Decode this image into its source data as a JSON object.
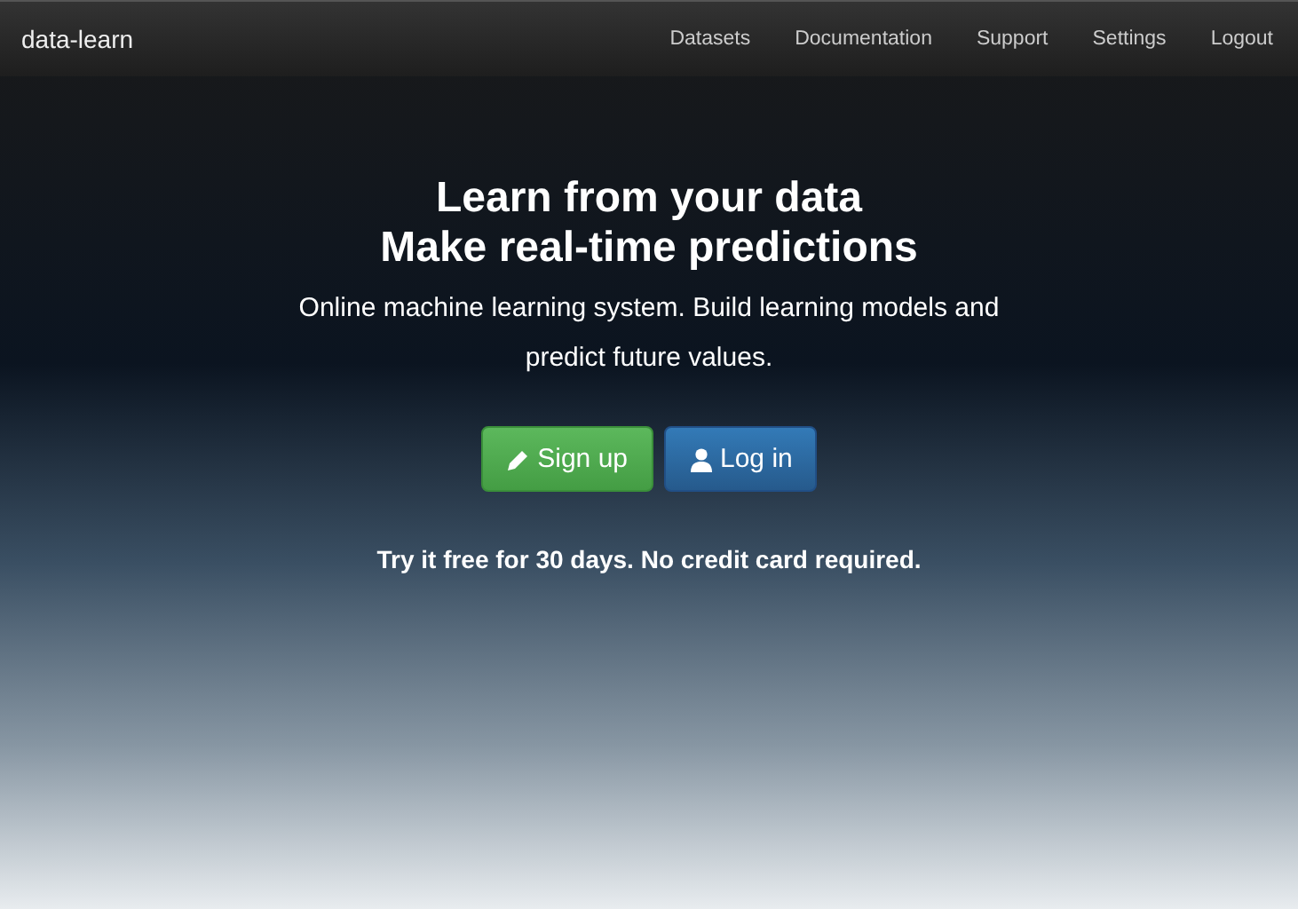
{
  "navbar": {
    "brand": "data-learn",
    "links": [
      "Datasets",
      "Documentation",
      "Support",
      "Settings",
      "Logout"
    ]
  },
  "hero": {
    "headline": [
      "Learn from your data",
      "Make real-time predictions"
    ],
    "description": "Online machine learning system. Build learning models and predict future values.",
    "buttons": [
      {
        "kind": "signup",
        "label": "Sign up"
      },
      {
        "kind": "login",
        "label": "Log in"
      }
    ],
    "note": "Try it free for 30 days. No credit card required."
  }
}
